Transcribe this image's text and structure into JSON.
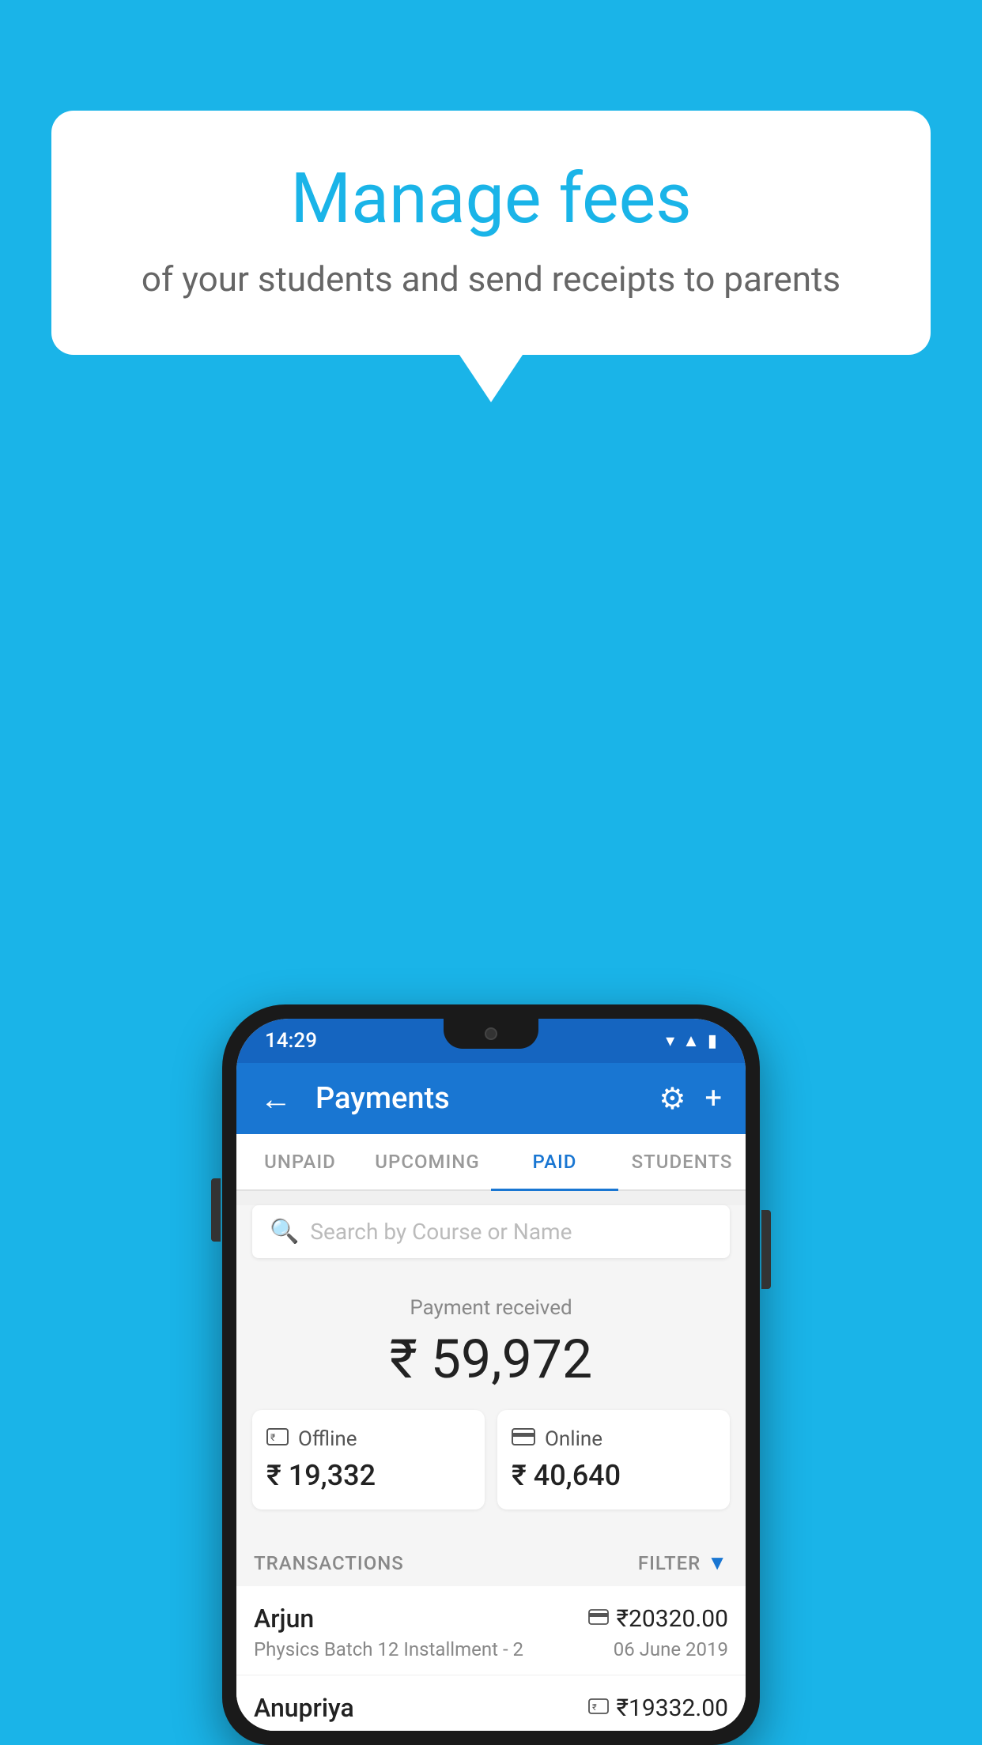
{
  "background_color": "#1ab4e8",
  "speech_bubble": {
    "title": "Manage fees",
    "subtitle": "of your students and send receipts to parents"
  },
  "status_bar": {
    "time": "14:29",
    "icons": [
      "wifi",
      "signal",
      "battery"
    ]
  },
  "app_bar": {
    "back_label": "←",
    "title": "Payments",
    "settings_label": "⚙",
    "add_label": "+"
  },
  "tabs": [
    {
      "id": "unpaid",
      "label": "UNPAID",
      "active": false
    },
    {
      "id": "upcoming",
      "label": "UPCOMING",
      "active": false
    },
    {
      "id": "paid",
      "label": "PAID",
      "active": true
    },
    {
      "id": "students",
      "label": "STUDENTS",
      "active": false
    }
  ],
  "search": {
    "placeholder": "Search by Course or Name",
    "icon": "🔍"
  },
  "payment_summary": {
    "label": "Payment received",
    "total": "₹ 59,972",
    "offline": {
      "type": "Offline",
      "amount": "₹ 19,332"
    },
    "online": {
      "type": "Online",
      "amount": "₹ 40,640"
    }
  },
  "transactions_section": {
    "label": "TRANSACTIONS",
    "filter_label": "FILTER"
  },
  "transactions": [
    {
      "name": "Arjun",
      "payment_type": "online",
      "amount": "₹20320.00",
      "course": "Physics Batch 12 Installment - 2",
      "date": "06 June 2019"
    },
    {
      "name": "Anupriya",
      "payment_type": "offline",
      "amount": "₹19332.00",
      "course": "",
      "date": ""
    }
  ]
}
